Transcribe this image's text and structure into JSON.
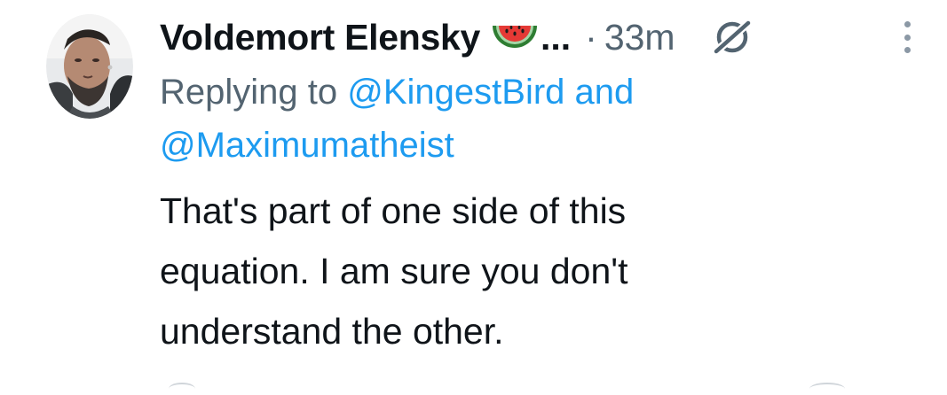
{
  "tweet": {
    "author_name": "Voldemort Elensky",
    "author_emoji": "watermelon-emoji",
    "truncation": "...",
    "separator": "·",
    "timestamp": "33m",
    "replying_prefix": "Replying to",
    "mention_1": "@KingestBird",
    "conjunction": "and",
    "mention_2": "@Maximumatheist",
    "body_lines": [
      "That's part of one side of this",
      "equation. I am sure you don't",
      "understand the other."
    ]
  },
  "colors": {
    "text_primary": "#0f1419",
    "text_secondary": "#536471",
    "link": "#1d9bf0"
  },
  "icons": {
    "grok": "grok-icon",
    "more": "more-options-icon"
  }
}
